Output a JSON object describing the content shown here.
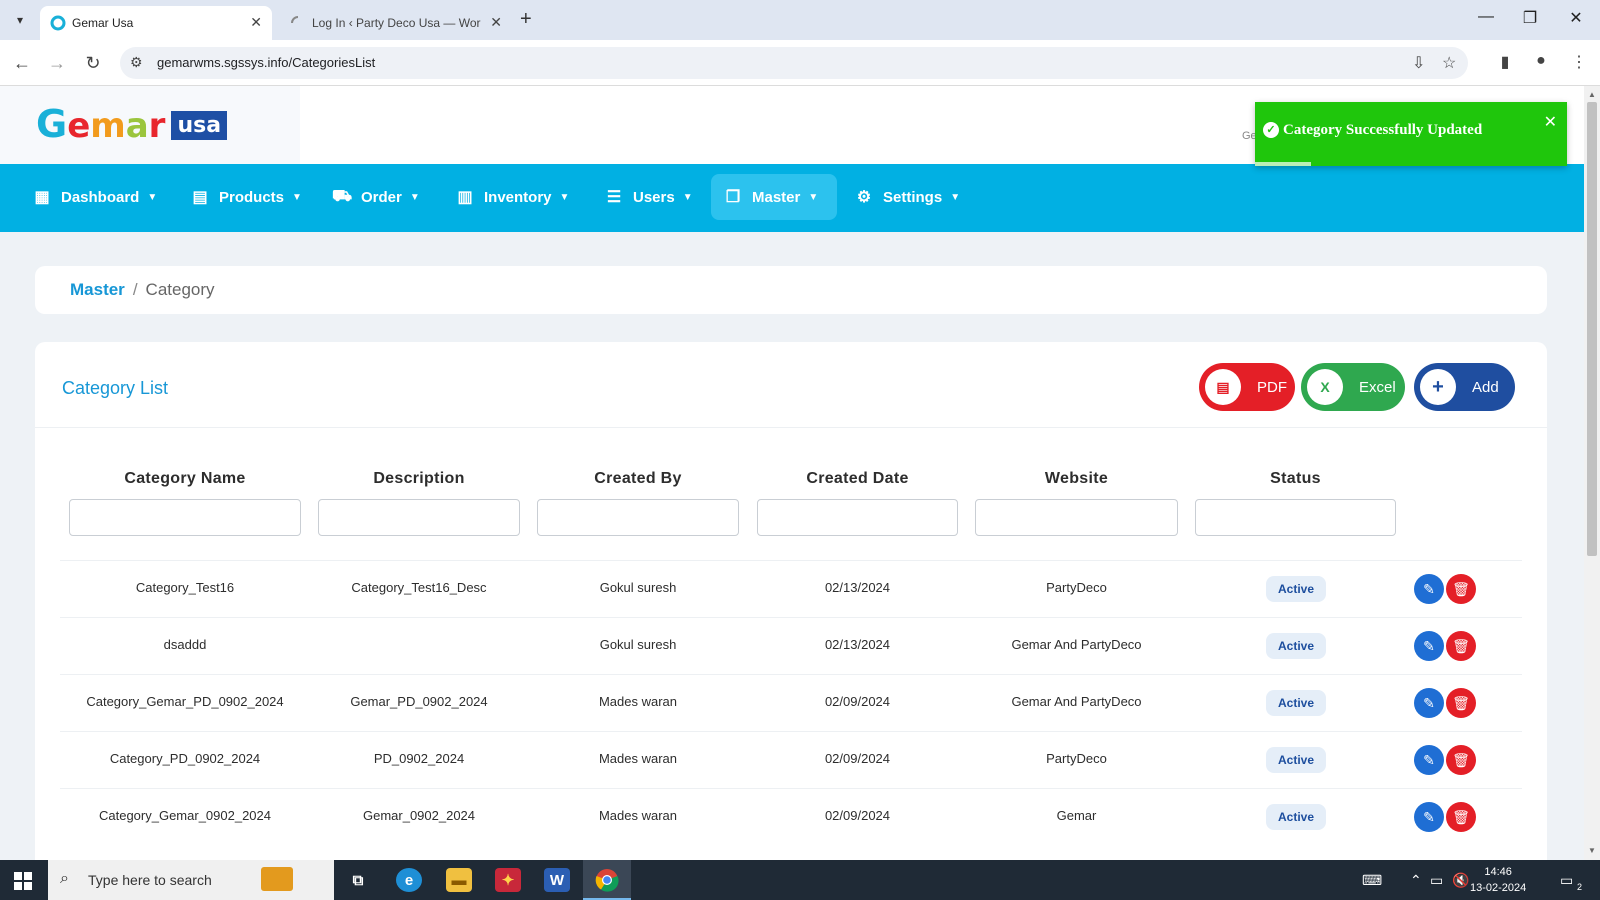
{
  "browser": {
    "tabs": [
      {
        "title": "Gemar Usa",
        "active": true
      },
      {
        "title": "Log In ‹ Party Deco Usa — Wor",
        "active": false
      }
    ],
    "url": "gemarwms.sgssys.info/CategoriesList"
  },
  "header": {
    "logo": {
      "g": "G",
      "emar": "emar",
      "usa": "usa"
    },
    "truncated_text": "Ge"
  },
  "toast": {
    "message": "Category Successfully Updated",
    "color": "#1fc60c"
  },
  "nav": {
    "items": [
      {
        "label": "Dashboard",
        "icon": "dashboard-icon"
      },
      {
        "label": "Products",
        "icon": "products-icon"
      },
      {
        "label": "Order",
        "icon": "cart-icon"
      },
      {
        "label": "Inventory",
        "icon": "inventory-icon"
      },
      {
        "label": "Users",
        "icon": "users-icon"
      },
      {
        "label": "Master",
        "icon": "master-icon",
        "active": true
      },
      {
        "label": "Settings",
        "icon": "settings-icon"
      }
    ],
    "accent": "#01b0e3"
  },
  "breadcrumb": {
    "parent": "Master",
    "separator": "/",
    "current": "Category"
  },
  "list": {
    "title": "Category List",
    "buttons": {
      "pdf": "PDF",
      "excel": "Excel",
      "add": "Add"
    },
    "columns": [
      "Category Name",
      "Description",
      "Created By",
      "Created Date",
      "Website",
      "Status"
    ],
    "rows": [
      {
        "name": "Category_Test16",
        "description": "Category_Test16_Desc",
        "created_by": "Gokul suresh",
        "created_date": "02/13/2024",
        "website": "PartyDeco",
        "status": "Active"
      },
      {
        "name": "dsaddd",
        "description": "",
        "created_by": "Gokul suresh",
        "created_date": "02/13/2024",
        "website": "Gemar And PartyDeco",
        "status": "Active"
      },
      {
        "name": "Category_Gemar_PD_0902_2024",
        "description": "Gemar_PD_0902_2024",
        "created_by": "Mades waran",
        "created_date": "02/09/2024",
        "website": "Gemar And PartyDeco",
        "status": "Active"
      },
      {
        "name": "Category_PD_0902_2024",
        "description": "PD_0902_2024",
        "created_by": "Mades waran",
        "created_date": "02/09/2024",
        "website": "PartyDeco",
        "status": "Active"
      },
      {
        "name": "Category_Gemar_0902_2024",
        "description": "Gemar_0902_2024",
        "created_by": "Mades waran",
        "created_date": "02/09/2024",
        "website": "Gemar",
        "status": "Active"
      }
    ]
  },
  "taskbar": {
    "search_placeholder": "Type here to search",
    "time": "14:46",
    "date": "13-02-2024",
    "notification_count": "2"
  }
}
